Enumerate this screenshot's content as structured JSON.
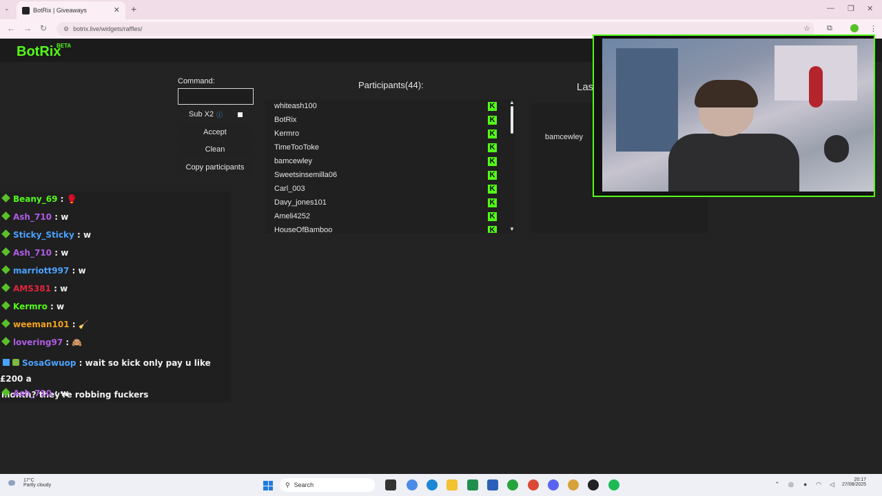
{
  "browser": {
    "tab_title": "BotRix | Giveaways",
    "url": "botrix.live/widgets/raffles/"
  },
  "app": {
    "logo": "BotRix",
    "logo_badge": "BETA",
    "brand_color": "#53fc18"
  },
  "controls": {
    "command_label": "Command:",
    "command_value": "",
    "sub_label": "Sub X2",
    "sub_info_icon": "info-icon",
    "sub_checked": false,
    "accept_label": "Accept",
    "clean_label": "Clean",
    "copy_label": "Copy participants"
  },
  "participants": {
    "title": "Participants(44):",
    "items": [
      "whiteash100",
      "BotRix",
      "Kermro",
      "TimeTooToke",
      "bamcewley",
      "Sweetsinsemilla06",
      "Carl_003",
      "Davy_jones101",
      "Ameli4252",
      "HouseOfBamboo"
    ],
    "badge_glyph": "K",
    "badge_icon": "kick-icon"
  },
  "last_winner": {
    "title_partial": "Las",
    "name": "bamcewley"
  },
  "chat": {
    "messages": [
      {
        "user": "Beany_69",
        "sep": ":",
        "text": "🥊",
        "color": "#53fc18"
      },
      {
        "user": "Ash_710",
        "sep": ":",
        "text": "w",
        "color": "#b05ce6"
      },
      {
        "user": "Sticky_Sticky",
        "sep": ":",
        "text": "w",
        "color": "#4aa3ff"
      },
      {
        "user": "Ash_710",
        "sep": ":",
        "text": "w",
        "color": "#b05ce6"
      },
      {
        "user": "marriott997",
        "sep": ":",
        "text": "w",
        "color": "#4aa3ff"
      },
      {
        "user": "AMS381",
        "sep": ":",
        "text": "w",
        "color": "#e0243c"
      },
      {
        "user": "Kermro",
        "sep": ":",
        "text": "w",
        "color": "#53fc18"
      },
      {
        "user": "weeman101",
        "sep": ":",
        "text": "🧹",
        "color": "#f3a21c"
      },
      {
        "user": "lovering97",
        "sep": ":",
        "text": "🙈",
        "color": "#b05ce6"
      },
      {
        "user": "SosaGwuop",
        "sep": ":",
        "text": "wait so kick only pay u like £200 a",
        "text2": "month? they're robbing fuckers",
        "color": "#4aa3ff"
      },
      {
        "user": "Ash_710",
        "sep": ":",
        "text": "w",
        "color": "#b05ce6"
      }
    ]
  },
  "taskbar": {
    "temp": "17°C",
    "weather": "Partly cloudy",
    "search_placeholder": "Search",
    "time": "20:17",
    "date": "27/08/2025"
  }
}
